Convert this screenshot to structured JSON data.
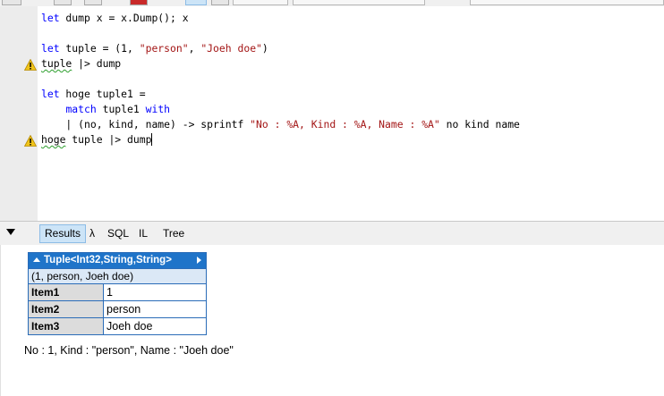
{
  "editor": {
    "lines": {
      "l1": {
        "kw": "let",
        "rest": " dump x = x.Dump(); x"
      },
      "l3": {
        "kw": "let",
        "rest": " tuple = (1, ",
        "s1": "\"person\"",
        "sep": ", ",
        "s2": "\"Joeh doe\"",
        "end": ")"
      },
      "l4": {
        "squig": "tuple",
        "rest": " |> dump"
      },
      "l6": {
        "kw": "let",
        "rest": " hoge tuple1 ="
      },
      "l7": {
        "indent": "    ",
        "kw": "match",
        "rest": " tuple1 ",
        "kw2": "with"
      },
      "l8": {
        "pre": "    | (no, kind, name) -> sprintf ",
        "fmt": "\"No : %A, Kind : %A, Name : %A\"",
        "post": " no kind name"
      },
      "l9": {
        "squig": "hoge",
        "rest": " tuple |> dump"
      }
    }
  },
  "tabs": {
    "results": "Results",
    "lambda": "λ",
    "sql": "SQL",
    "il": "IL",
    "tree": "Tree"
  },
  "dump": {
    "header": "Tuple<Int32,String,String>",
    "summary": "(1, person, Joeh doe)",
    "rows": [
      {
        "key": "Item1",
        "value": "1"
      },
      {
        "key": "Item2",
        "value": "person"
      },
      {
        "key": "Item3",
        "value": "Joeh doe"
      }
    ]
  },
  "output": "No : 1, Kind : \"person\", Name : \"Joeh doe\"",
  "colors": {
    "keyword": "#0000ff",
    "string": "#a31515",
    "dump_header": "#1f74c9",
    "warning": "#f0c419"
  }
}
